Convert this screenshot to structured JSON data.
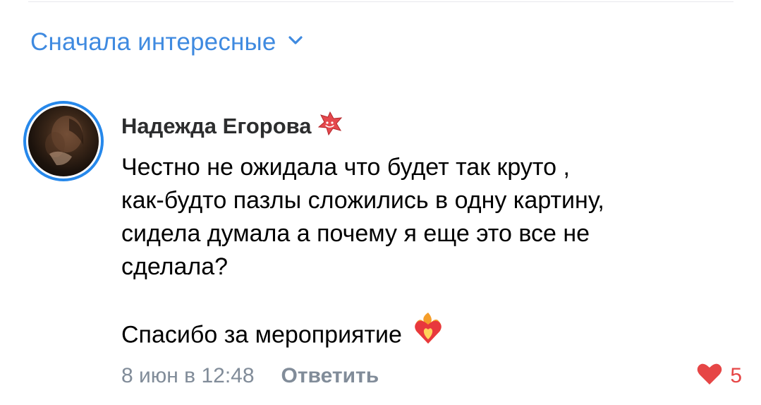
{
  "sort": {
    "label": "Сначала интересные",
    "chevron_icon": "chevron-down-icon",
    "color": "#3f8ae0"
  },
  "comment": {
    "author": "Надежда Егорова",
    "badge_icon": "red-star-sticker-icon",
    "avatar_ring_color": "#2688eb",
    "text_lines": [
      "Честно не ожидала что будет так круто ,",
      "как-будто пазлы сложились в одну картину,",
      "сидела думала а почему я еще это все не",
      "сделала?"
    ],
    "thanks": "Спасибо за мероприятие",
    "thanks_emoji": "heart-on-fire-icon",
    "date": "8 июн в 12:48",
    "reply_label": "Ответить",
    "likes": "5",
    "like_icon": "heart-icon",
    "like_color": "#e64646"
  }
}
